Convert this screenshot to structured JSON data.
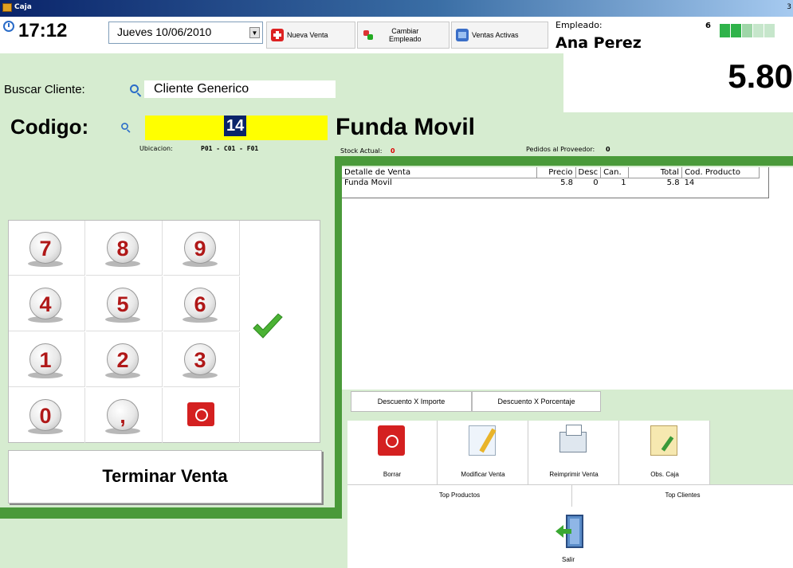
{
  "window": {
    "title": "Caja",
    "corner_mark": "3"
  },
  "toolbar": {
    "time": "17:12",
    "date": "Jueves   10/06/2010",
    "buttons": {
      "nueva_venta": "Nueva Venta",
      "cambiar_empleado_1": "Cambiar",
      "cambiar_empleado_2": "Empleado",
      "ventas_activas": "Ventas Activas"
    },
    "empleado_label": "Empleado:",
    "empleado_name": "Ana Perez",
    "empleado_count": "6"
  },
  "cliente": {
    "label": "Buscar Cliente:",
    "value": "Cliente Generico"
  },
  "total": "5.80",
  "codigo": {
    "label": "Codigo:",
    "value": "14",
    "ubicacion_label": "Ubicacion:",
    "ubicacion_value": "P01 - C01 - F01"
  },
  "producto": {
    "name": "Funda Movil",
    "stock_label": "Stock Actual:",
    "stock_value": "0",
    "pedidos_label": "Pedidos al Proveedor:",
    "pedidos_value": "0"
  },
  "grid": {
    "headers": [
      "Detalle de Venta",
      "Precio",
      "Desc",
      "Can.",
      "Total",
      "Cod. Producto"
    ],
    "rows": [
      [
        "Funda Movil",
        "5.8",
        "0",
        "1",
        "5.8",
        "14"
      ]
    ]
  },
  "keypad": {
    "keys": [
      "7",
      "8",
      "9",
      "4",
      "5",
      "6",
      "1",
      "2",
      "3",
      "0",
      ","
    ],
    "terminar": "Terminar Venta"
  },
  "descuentos": {
    "importe": "Descuento X Importe",
    "porcentaje": "Descuento X Porcentaje"
  },
  "actions": {
    "borrar": "Borrar",
    "modificar": "Modificar Venta",
    "reimprimir": "Reimprimir Venta",
    "obs": "Obs. Caja"
  },
  "tops": {
    "productos": "Top Productos",
    "clientes": "Top Clientes"
  },
  "salir": "Salir",
  "colors": {
    "frame_green": "#4a9a3a",
    "background": "#d6ecd0",
    "codigo_yellow": "#ffff00",
    "digit_red": "#b01818"
  }
}
